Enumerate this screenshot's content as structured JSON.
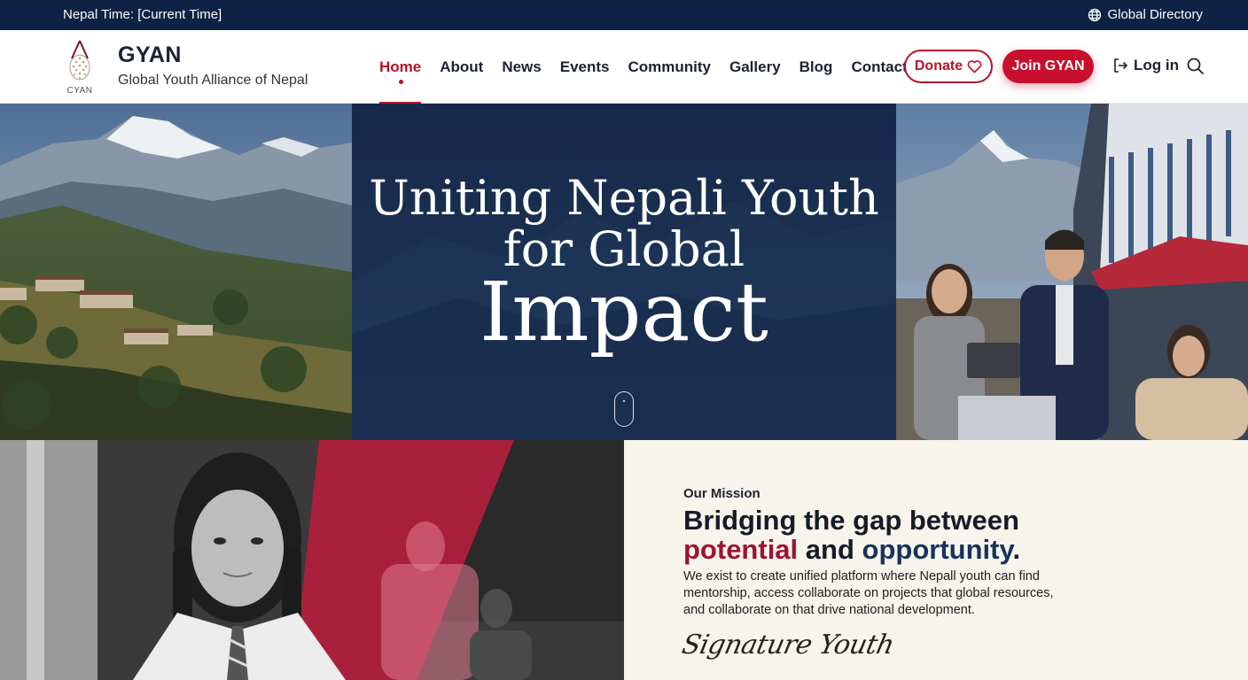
{
  "topbar": {
    "time_text": "Nepal Time: [Current Time]",
    "directory_label": "Global Directory",
    "directory_icon": "globe-icon"
  },
  "brand": {
    "name": "GYAN",
    "subtitle": "Global Youth Alliance of Nepal",
    "logo_text": "CYAN"
  },
  "nav": {
    "items": [
      "Home",
      "About",
      "News",
      "Events",
      "Community",
      "Gallery",
      "Blog",
      "Contact"
    ],
    "active": "Home"
  },
  "actions": {
    "donate_label": "Donate",
    "donate_icon": "heart-icon",
    "join_label": "Join GYAN",
    "login_label": "Log in",
    "login_icon": "login-icon",
    "search_icon": "search-icon"
  },
  "hero": {
    "title_line1": "Uniting Nepali Youth",
    "title_line2": "for Global",
    "title_line3": "Impact"
  },
  "mission": {
    "eyebrow": "Our Mission",
    "heading_line1": "Bridging the gap between",
    "heading_word_red": "potential",
    "heading_word_and": "and",
    "heading_word_blue": "opportunity",
    "heading_period": ".",
    "body": "We exist to create unified platform where Nepall youth can find mentorship, access collaborate on projects that global resources, and collaborate on that drive national development.",
    "signature": "Signature Youth"
  },
  "colors": {
    "navy": "#0d2244",
    "accent_red": "#c8102e",
    "mission_bg": "#f7f4ec"
  }
}
